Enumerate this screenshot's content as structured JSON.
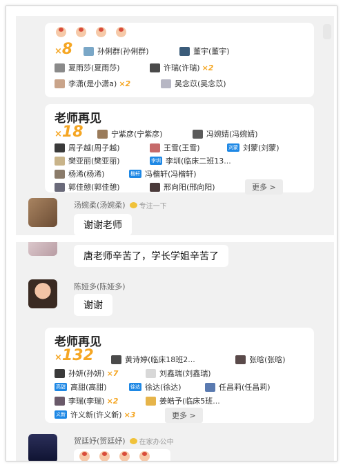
{
  "screenshot_1": {
    "top_card": {
      "count": "8",
      "entries": [
        {
          "name": "孙俐群(孙俐群)",
          "avatar_color": "#7aa7c7"
        },
        {
          "name": "董宇(董宇)",
          "avatar_color": "#3b5c7a"
        },
        {
          "name": "夏雨莎(夏雨莎)",
          "avatar_color": "#8a8a8a"
        },
        {
          "name": "许瑞(许瑞)",
          "avatar_color": "#4a4a4a",
          "mult": "×2"
        },
        {
          "name": "李潇(是小潇a)",
          "avatar_color": "#c9a48a",
          "mult": "×2"
        },
        {
          "name": "吴念苡(吴念苡)",
          "avatar_color": "#b7b7c4"
        }
      ]
    },
    "card": {
      "title": "老师再见",
      "count": "18",
      "entries": [
        {
          "name": "宁紫彦(宁紫彦)",
          "avatar_color": "#9a7b5a"
        },
        {
          "name": "冯婉婧(冯婉婧)",
          "avatar_color": "#5a5a5a"
        },
        {
          "name": "周子越(周子越)",
          "avatar_color": "#3a3a3a"
        },
        {
          "name": "王雪(王雪)",
          "avatar_color": "#c66a6a"
        },
        {
          "name": "刘蒙(刘蒙)",
          "badge": "刘蒙"
        },
        {
          "name": "樊亚丽(樊亚丽)",
          "avatar_color": "#c9b48a"
        },
        {
          "name": "李圳(临床二班13...",
          "badge": "李圳"
        },
        {
          "name": "杨浠(杨浠)",
          "avatar_color": "#8a7b6a"
        },
        {
          "name": "冯楷轩(冯楷轩)",
          "badge": "楷轩"
        },
        {
          "name": "郭佳憩(郭佳憩)",
          "avatar_color": "#6a6a7a"
        },
        {
          "name": "邢向阳(邢向阳)",
          "avatar_color": "#4a3a3a"
        }
      ],
      "more_label": "更多 >"
    },
    "message": {
      "sender": "汤婉柔(汤婉柔)",
      "status": "专注一下",
      "text": "谢谢老师"
    }
  },
  "screenshot_2": {
    "message_1": {
      "text": "唐老师辛苦了，学长学姐辛苦了"
    },
    "message_2": {
      "sender": "陈娅多(陈娅多)",
      "text": "谢谢"
    },
    "card": {
      "title": "老师再见",
      "count": "132",
      "entries": [
        {
          "name": "黄诗婷(临床18班2...",
          "avatar_color": "#4a4a4a"
        },
        {
          "name": "张晗(张晗)",
          "avatar_color": "#5a4a4a"
        },
        {
          "name": "孙妍(孙妍)",
          "avatar_color": "#3a3a3a",
          "mult": "×7"
        },
        {
          "name": "刘鑫瑞(刘鑫瑞)",
          "avatar_color": "#d8d8d8"
        },
        {
          "name": "高甜(高甜)",
          "badge": "高甜"
        },
        {
          "name": "徐达(徐达)",
          "badge": "徐达"
        },
        {
          "name": "任昌莉(任昌莉)",
          "avatar_color": "#5a7ab0"
        },
        {
          "name": "李瑞(李瑞)",
          "avatar_color": "#6a5a6a",
          "mult": "×2"
        },
        {
          "name": "姜皓予(临床5班...",
          "avatar_color": "#e6b44a"
        },
        {
          "name": "许义新(许义新)",
          "badge": "义新",
          "mult": "×3"
        }
      ],
      "more_label": "更多 >"
    },
    "message_3": {
      "sender": "贺廷妤(贺廷妤)",
      "status": "在家办公中"
    }
  }
}
